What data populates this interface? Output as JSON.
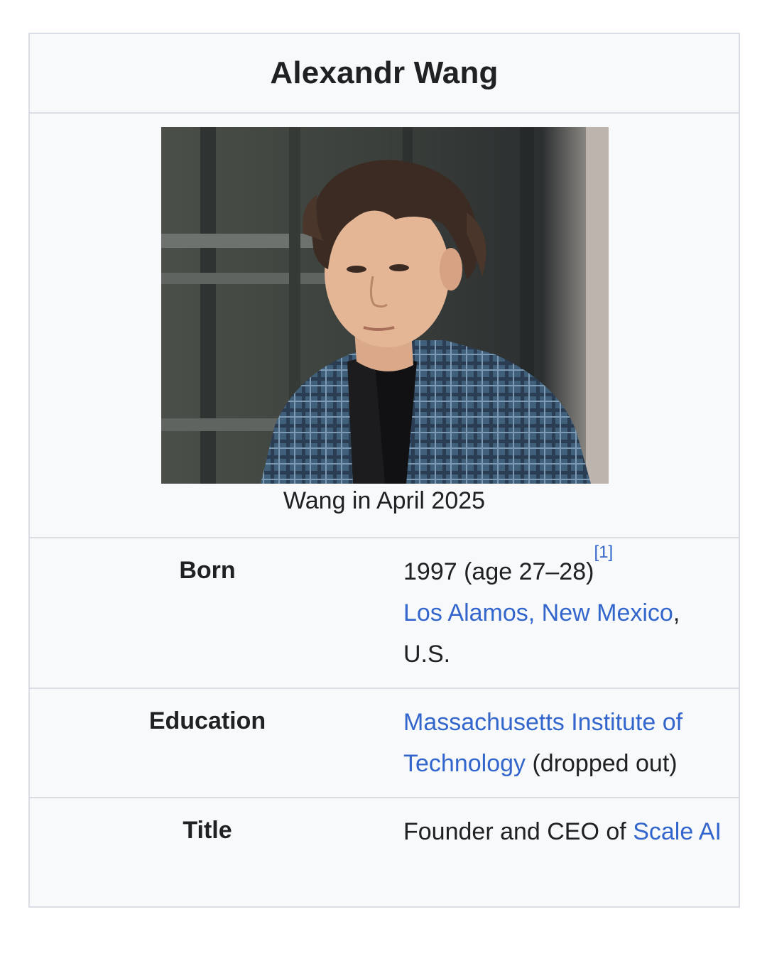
{
  "infobox": {
    "title": "Alexandr Wang",
    "image_caption": "Wang in April 2025",
    "born": {
      "label": "Born",
      "date": "1997 (age 27–28)",
      "ref": "[1]",
      "place_link": "Los Alamos, New Mexico",
      "place_sep": ",",
      "country": "U.S."
    },
    "education": {
      "label": "Education",
      "school_link": "Massachusetts Institute of Technology",
      "note": " (dropped out)"
    },
    "title_row": {
      "label": "Title",
      "text": "Founder and CEO of ",
      "company_link": "Scale AI"
    }
  },
  "colors": {
    "link": "#3366cc",
    "border": "#dadde3",
    "background": "#f8f9fa"
  }
}
